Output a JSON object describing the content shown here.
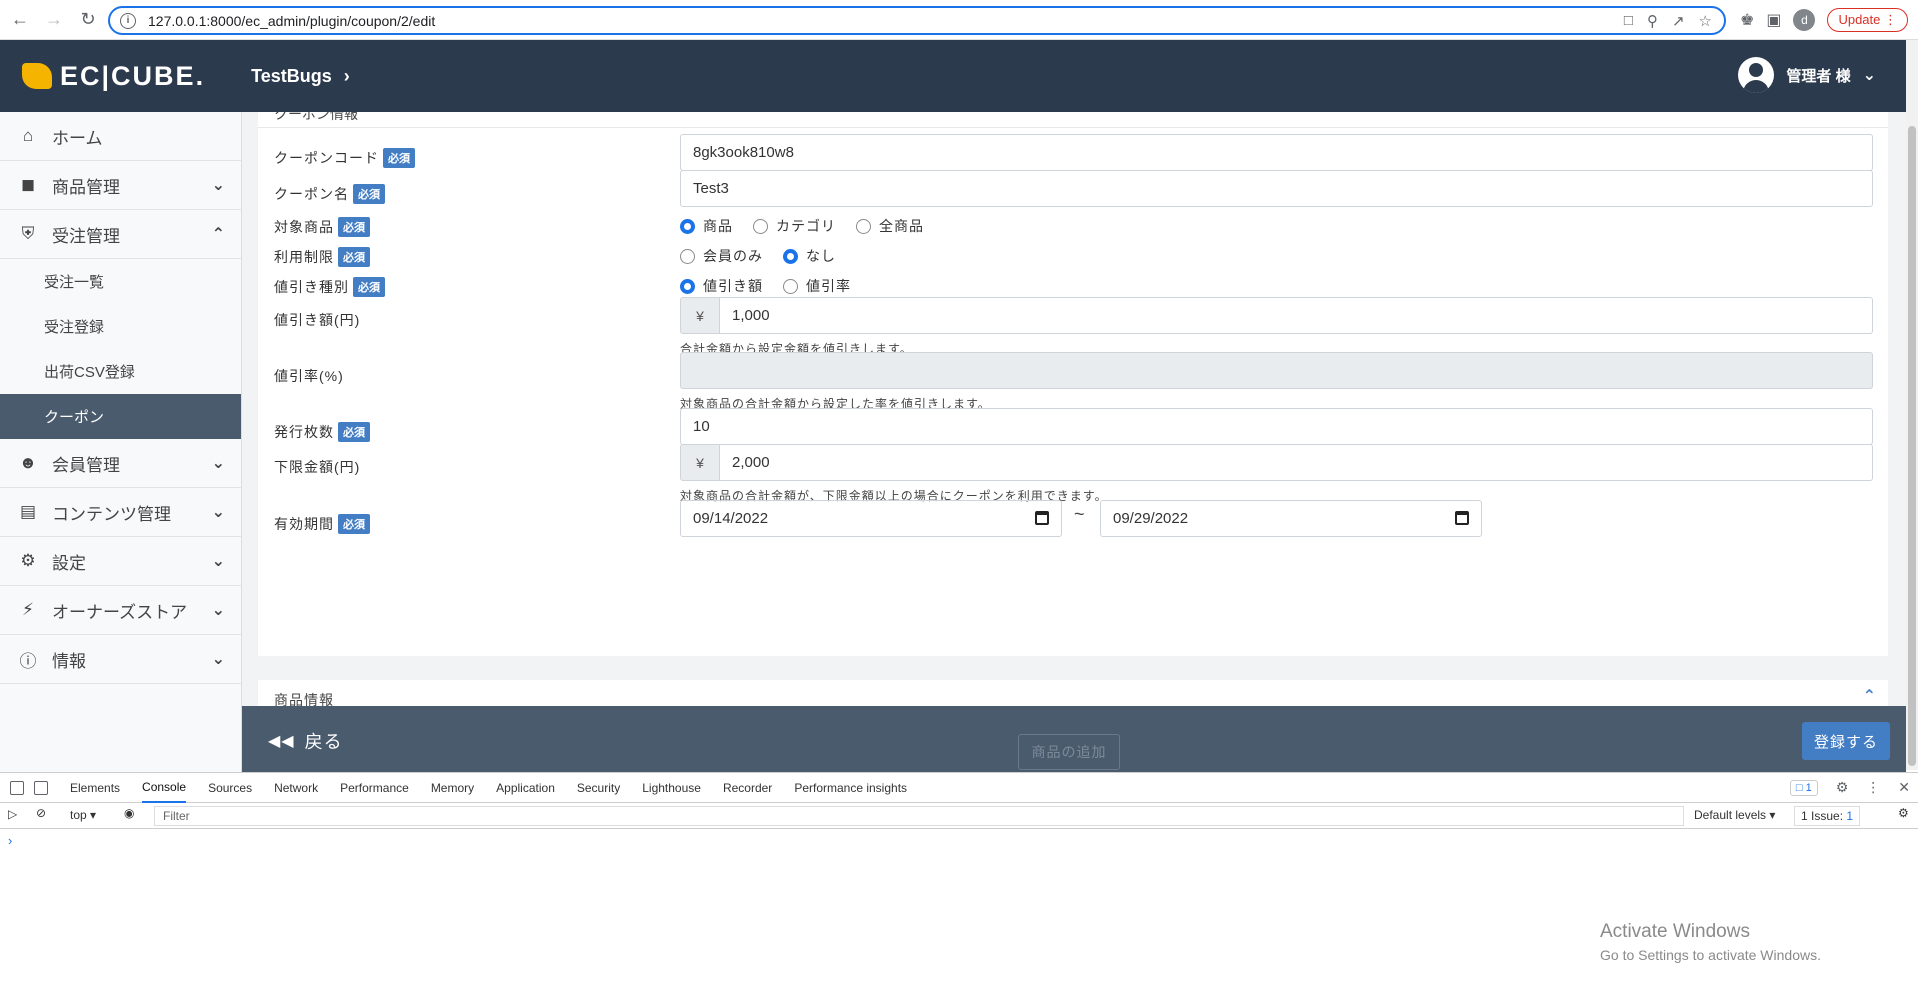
{
  "browser": {
    "url": "127.0.0.1:8000/ec_admin/plugin/coupon/2/edit",
    "profile_initial": "d",
    "update_label": "Update"
  },
  "header": {
    "logo_text": "EC|CUBE.",
    "shop_name": "TestBugs",
    "admin_name": "管理者 様"
  },
  "sidebar": {
    "items": [
      {
        "label": "ホーム",
        "icon": "home-icon"
      },
      {
        "label": "商品管理",
        "icon": "box-icon"
      },
      {
        "label": "受注管理",
        "icon": "cart-icon"
      },
      {
        "label": "会員管理",
        "icon": "users-icon"
      },
      {
        "label": "コンテンツ管理",
        "icon": "file-icon"
      },
      {
        "label": "設定",
        "icon": "gear-icon"
      },
      {
        "label": "オーナーズストア",
        "icon": "plug-icon"
      },
      {
        "label": "情報",
        "icon": "info-icon"
      }
    ],
    "sub_items": [
      "受注一覧",
      "受注登録",
      "出荷CSV登録",
      "クーポン"
    ]
  },
  "form": {
    "section_title": "クーポン情報",
    "required_badge": "必須",
    "code_label": "クーポンコード",
    "code_value": "8gk3ook810w8",
    "name_label": "クーポン名",
    "name_value": "Test3",
    "target_label": "対象商品",
    "target_options": [
      "商品",
      "カテゴリ",
      "全商品"
    ],
    "restrict_label": "利用制限",
    "restrict_options": [
      "会員のみ",
      "なし"
    ],
    "discount_type_label": "値引き種別",
    "discount_type_options": [
      "値引き額",
      "値引率"
    ],
    "discount_amount_label": "値引き額(円)",
    "currency_symbol": "¥",
    "discount_amount_value": "1,000",
    "discount_amount_help": "合計金額から設定金額を値引きします。",
    "discount_rate_label": "値引率(%)",
    "discount_rate_help": "対象商品の合計金額から設定した率を値引きします。",
    "issue_count_label": "発行枚数",
    "issue_count_value": "10",
    "lower_limit_label": "下限金額(円)",
    "lower_limit_value": "2,000",
    "lower_limit_help": "対象商品の合計金額が、下限金額以上の場合にクーポンを利用できます。",
    "period_label": "有効期間",
    "period_start": "09/14/2022",
    "period_separator": "~",
    "period_end": "09/29/2022",
    "product_section_title": "商品情報"
  },
  "actions": {
    "back_label": "戻る",
    "add_product_label": "商品の追加",
    "submit_label": "登録する"
  },
  "devtools": {
    "tabs": [
      "Elements",
      "Console",
      "Sources",
      "Network",
      "Performance",
      "Memory",
      "Application",
      "Security",
      "Lighthouse",
      "Recorder",
      "Performance insights"
    ],
    "message_count": "1",
    "context": "top",
    "filter_placeholder": "Filter",
    "levels": "Default levels",
    "issues": "1 Issue:",
    "issues_count": "1",
    "prompt": "›"
  },
  "watermark": {
    "line1": "Activate Windows",
    "line2": "Go to Settings to activate Windows."
  }
}
